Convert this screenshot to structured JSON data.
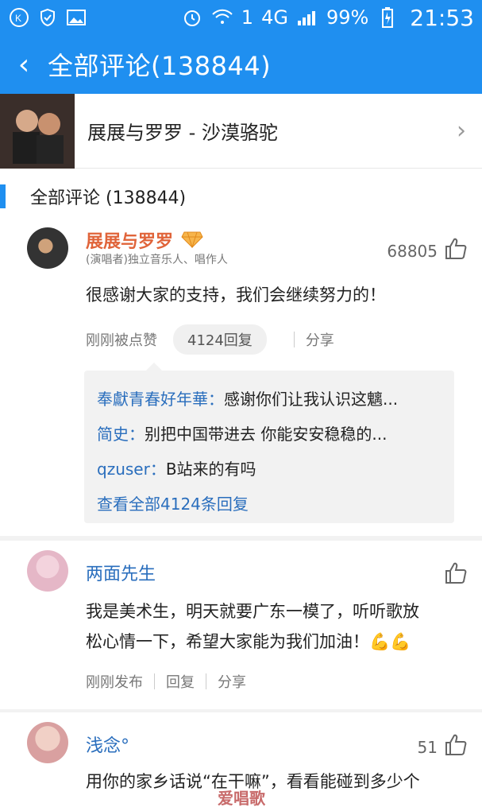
{
  "statusbar": {
    "battery": "99%",
    "time": "21:53",
    "network": "4G",
    "sim": "1"
  },
  "header": {
    "title": "全部评论(138844)"
  },
  "song": {
    "title": "展展与罗罗 - 沙漠骆驼"
  },
  "section": {
    "title": "全部评论 (138844)"
  },
  "comments": [
    {
      "name": "展展与罗罗",
      "role": "(演唱者)独立音乐人、唱作人",
      "likes": "68805",
      "text": "很感谢大家的支持，我们会继续努力的！",
      "meta": {
        "time": "刚刚被点赞",
        "replies": "4124回复",
        "share": "分享"
      },
      "replies_preview": [
        {
          "user": "奉獻青春好年華：",
          "text": "感谢你们让我认识这魑..."
        },
        {
          "user": "简史：",
          "text": "别把中国带进去  你能安安稳稳的..."
        },
        {
          "user": "qzuser：",
          "text": "B站来的有吗"
        }
      ],
      "view_all": "查看全部4124条回复"
    },
    {
      "name": "两面先生",
      "text_lines": [
        "我是美术生，明天就要广东一模了，听听歌放",
        "松心情一下，希望大家能为我们加油！💪💪"
      ],
      "meta": {
        "time": "刚刚发布",
        "reply": "回复",
        "share": "分享"
      }
    },
    {
      "name": "浅念°",
      "likes": "51",
      "text": "用你的家乡话说“在干嘛”，看看能碰到多少个"
    }
  ],
  "watermark": "爱唱歌"
}
